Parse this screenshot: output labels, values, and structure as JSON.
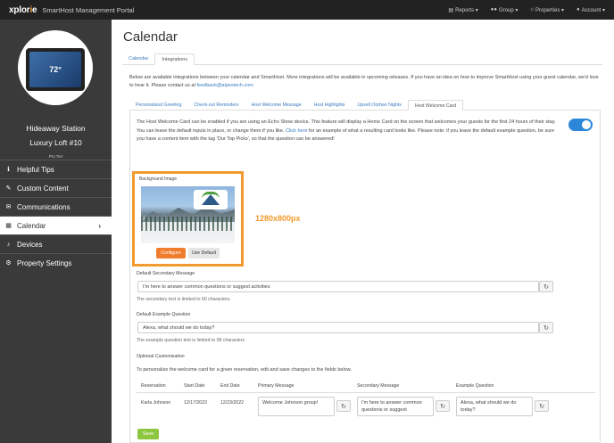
{
  "topnav": {
    "logo_pre": "xplor",
    "logo_o": "i",
    "logo_post": "e",
    "portal_title": "SmartHost Management Portal",
    "items": [
      {
        "icon": "chart-icon",
        "label": "Reports ▾"
      },
      {
        "icon": "group-icon",
        "label": "Group ▾"
      },
      {
        "icon": "home-icon",
        "label": "Properties ▾"
      },
      {
        "icon": "user-icon",
        "label": "Account ▾"
      }
    ]
  },
  "sidebar": {
    "device_temp": "72°",
    "station_name": "Hideaway Station",
    "station_unit": "Luxury Loft #10",
    "tier": "Pro Tier",
    "menu": [
      {
        "icon": "info-icon",
        "label": "Helpful Tips"
      },
      {
        "icon": "pencil-icon",
        "label": "Custom Content"
      },
      {
        "icon": "envelope-icon",
        "label": "Communications"
      },
      {
        "icon": "calendar-icon",
        "label": "Calendar",
        "active": true
      },
      {
        "icon": "bell-icon",
        "label": "Devices"
      },
      {
        "icon": "gear-icon",
        "label": "Property Settings"
      }
    ]
  },
  "main": {
    "title": "Calendar",
    "tabs": [
      "Calendar",
      "Integrations"
    ],
    "active_tab": "Integrations",
    "intro_text": "Below are available integrations between your calendar and SmartHost. More integrations will be available in upcoming releases. If you have an idea on how to improve SmartHost using your guest calendar, we'd love to hear it. Please contact us at ",
    "intro_email": "feedback@alpextech.com",
    "subtabs": [
      "Personalized Greeting",
      "Check-out Reminders",
      "Host Welcome Message",
      "Host Highlights",
      "Upsell Orphan Nights",
      "Host Welcome Card"
    ],
    "active_subtab": "Host Welcome Card",
    "card": {
      "desc_1": "The Host Welcome Card can be enabled if you are using an Echo Show device. This feature will display a Home Card on the screen that welcomes your guests for the first 24 hours of their stay. You can leave the default inputs in place, or change them if you like. ",
      "desc_link": "Click here",
      "desc_2": " for an example of what a resulting card looks like. Please note: if you leave the default example question, be sure you have a content item with the tag 'Our Top Picks', so that the question can be answered!",
      "enabled": true,
      "bg_label": "Background Image",
      "configure_label": "Configure",
      "use_default_label": "Use Default",
      "size_note": "1280x800px",
      "secondary_label": "Default Secondary Message",
      "secondary_value": "I'm here to answer common questions or suggest activities",
      "secondary_help": "The secondary text is limited to 60 characters.",
      "question_label": "Default Example Question",
      "question_value": "Alexa, what should we do today?",
      "question_help": "The example question text is limited to 58 characters",
      "opt_title": "Optional Customization",
      "opt_desc": "To personalize the welcome card for a given reservation, edit and save changes to the fields below.",
      "table_headers": [
        "Reservation",
        "Start Date",
        "End Date",
        "Primary Message",
        "Secondary Message",
        "Example Question"
      ],
      "row": {
        "reservation": "Karla Johnson",
        "start": "12/17/2022",
        "end": "12/23/2022",
        "primary": "Welcome Johnson group!",
        "secondary": "I'm here to answer common questions or suggest",
        "question": "Alexa, what should we do today?"
      },
      "save_label": "Save"
    }
  }
}
